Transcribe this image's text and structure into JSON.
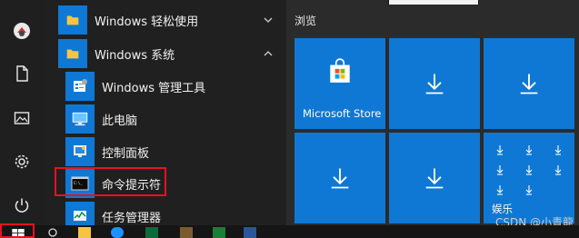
{
  "menu": {
    "items": [
      {
        "label": "Windows 轻松使用",
        "kind": "folder",
        "chevron": "chevron-down-icon"
      },
      {
        "label": "Windows 系统",
        "kind": "folder",
        "chevron": "chevron-up-icon"
      },
      {
        "label": "Windows 管理工具",
        "kind": "admin-tools-icon"
      },
      {
        "label": "此电脑",
        "kind": "computer-icon"
      },
      {
        "label": "控制面板",
        "kind": "control-panel-icon"
      },
      {
        "label": "命令提示符",
        "kind": "terminal-icon",
        "highlighted": true
      },
      {
        "label": "任务管理器",
        "kind": "task-manager-icon"
      }
    ]
  },
  "tiles": {
    "section_title": "浏览",
    "items": [
      {
        "label": "Microsoft Store",
        "icon": "store-icon"
      },
      {
        "label": "",
        "icon": "download-arrow-icon"
      },
      {
        "label": "",
        "icon": "download-arrow-icon"
      },
      {
        "label": "",
        "icon": "download-arrow-icon"
      },
      {
        "label": "",
        "icon": "download-arrow-icon"
      },
      {
        "label": "娱乐",
        "icon": "download-grid-icon"
      }
    ]
  },
  "watermark": "CSDN @小青龍",
  "colors": {
    "tile_blue": "#0f78d4",
    "menu_bg": "#202020",
    "highlight_red": "#e81123"
  }
}
